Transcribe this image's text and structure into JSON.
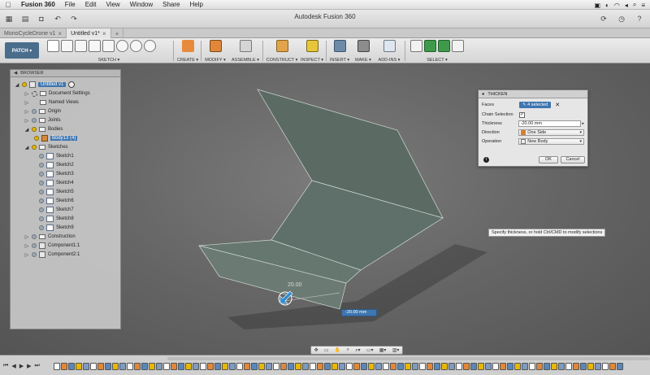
{
  "menubar": {
    "apple": "",
    "items": [
      "Fusion 360",
      "File",
      "Edit",
      "View",
      "Window",
      "Share",
      "Help"
    ]
  },
  "window": {
    "title": "Autodesk Fusion 360"
  },
  "doc_tabs": [
    {
      "label": "MonoCycleDrone v1",
      "active": false
    },
    {
      "label": "Untitled v1*",
      "active": true
    }
  ],
  "ribbon": {
    "workspace": "PATCH ▾",
    "groups": [
      "SKETCH ▾",
      "CREATE ▾",
      "MODIFY ▾",
      "ASSEMBLE ▾",
      "CONSTRUCT ▾",
      "INSPECT ▾",
      "INSERT ▾",
      "MAKE ▾",
      "ADD-INS ▾",
      "SELECT ▾"
    ]
  },
  "browser": {
    "header": "BROWSER",
    "root": "Untitled v1",
    "items": [
      {
        "label": "Document Settings"
      },
      {
        "label": "Named Views"
      },
      {
        "label": "Origin"
      },
      {
        "label": "Joints"
      },
      {
        "label": "Bodies"
      },
      {
        "label": "Body13 (4)"
      },
      {
        "label": "Sketches"
      },
      {
        "label": "Sketch1"
      },
      {
        "label": "Sketch2"
      },
      {
        "label": "Sketch3"
      },
      {
        "label": "Sketch4"
      },
      {
        "label": "Sketch5"
      },
      {
        "label": "Sketch6"
      },
      {
        "label": "Sketch7"
      },
      {
        "label": "Sketch8"
      },
      {
        "label": "Sketch9"
      },
      {
        "label": "Construction"
      },
      {
        "label": "Component1:1"
      },
      {
        "label": "Component2:1"
      }
    ]
  },
  "thicken": {
    "title": "THICKEN",
    "faces_label": "Faces",
    "faces_value": "4 selected",
    "chain_label": "Chain Selection",
    "thickness_label": "Thickness",
    "thickness_value": "-20.00 mm",
    "direction_label": "Direction",
    "direction_value": "One Side",
    "operation_label": "Operation",
    "operation_value": "New Body",
    "ok": "OK",
    "cancel": "Cancel"
  },
  "hint": "Specify thickness, or hold Ctrl/CMD to modify selections",
  "manipulator": {
    "label": "20.00",
    "input": "-20.00 mm"
  },
  "colors": {
    "selection_blue": "#3f76b0",
    "surface": "#5b6c65"
  }
}
